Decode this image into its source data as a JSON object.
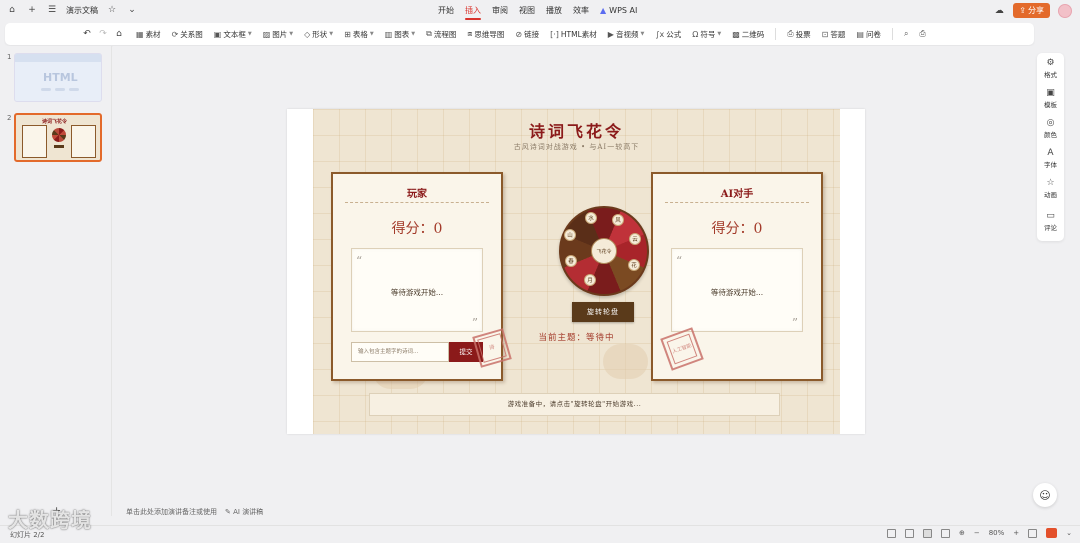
{
  "app": {
    "doc_title": "演示文稿",
    "menu": [
      "开始",
      "插入",
      "审阅",
      "视图",
      "播放",
      "效率",
      "WPS AI"
    ],
    "active_menu": "插入",
    "share_label": "分享",
    "accent": "#e36a2b"
  },
  "toolbar": {
    "items": [
      "素材",
      "关系图",
      "文本框",
      "图片",
      "形状",
      "表格",
      "图表",
      "流程图",
      "思维导图",
      "链接",
      "HTML素材",
      "音视频",
      "公式",
      "符号",
      "二维码",
      "投票",
      "答题",
      "问卷"
    ]
  },
  "slides": {
    "numbers": [
      "1",
      "2"
    ],
    "thumb1_text": "HTML",
    "thumb2_title": "诗词飞花令"
  },
  "game": {
    "title": "诗词飞花令",
    "subtitle": "古风诗词对战游戏 • 与AI一较高下",
    "player": {
      "name": "玩家",
      "score": "得分：0",
      "verse": "等待游戏开始...",
      "input_placeholder": "输入包含主题字的诗词...",
      "submit": "提交",
      "seal": "诗"
    },
    "ai": {
      "name": "AI对手",
      "score": "得分：0",
      "verse": "等待游戏开始...",
      "seal": "人工智能"
    },
    "wheel": {
      "center": "飞花令",
      "labels": [
        "风",
        "云",
        "花",
        "月",
        "春",
        "山",
        "水"
      ]
    },
    "spin_label": "旋转轮盘",
    "theme": "当前主题：等待中",
    "status": "游戏准备中，请点击\"旋转轮盘\"开始游戏..."
  },
  "right_panel": [
    "格式",
    "模板",
    "颜色",
    "字体",
    "动画",
    "评论"
  ],
  "notes": {
    "placeholder": "单击此处添加演讲备注或使用",
    "ai_notes": "AI 演讲稿"
  },
  "statusbar": {
    "slide_counter": "幻灯片 2/2",
    "zoom": "80%"
  },
  "watermark": "大数跨境"
}
